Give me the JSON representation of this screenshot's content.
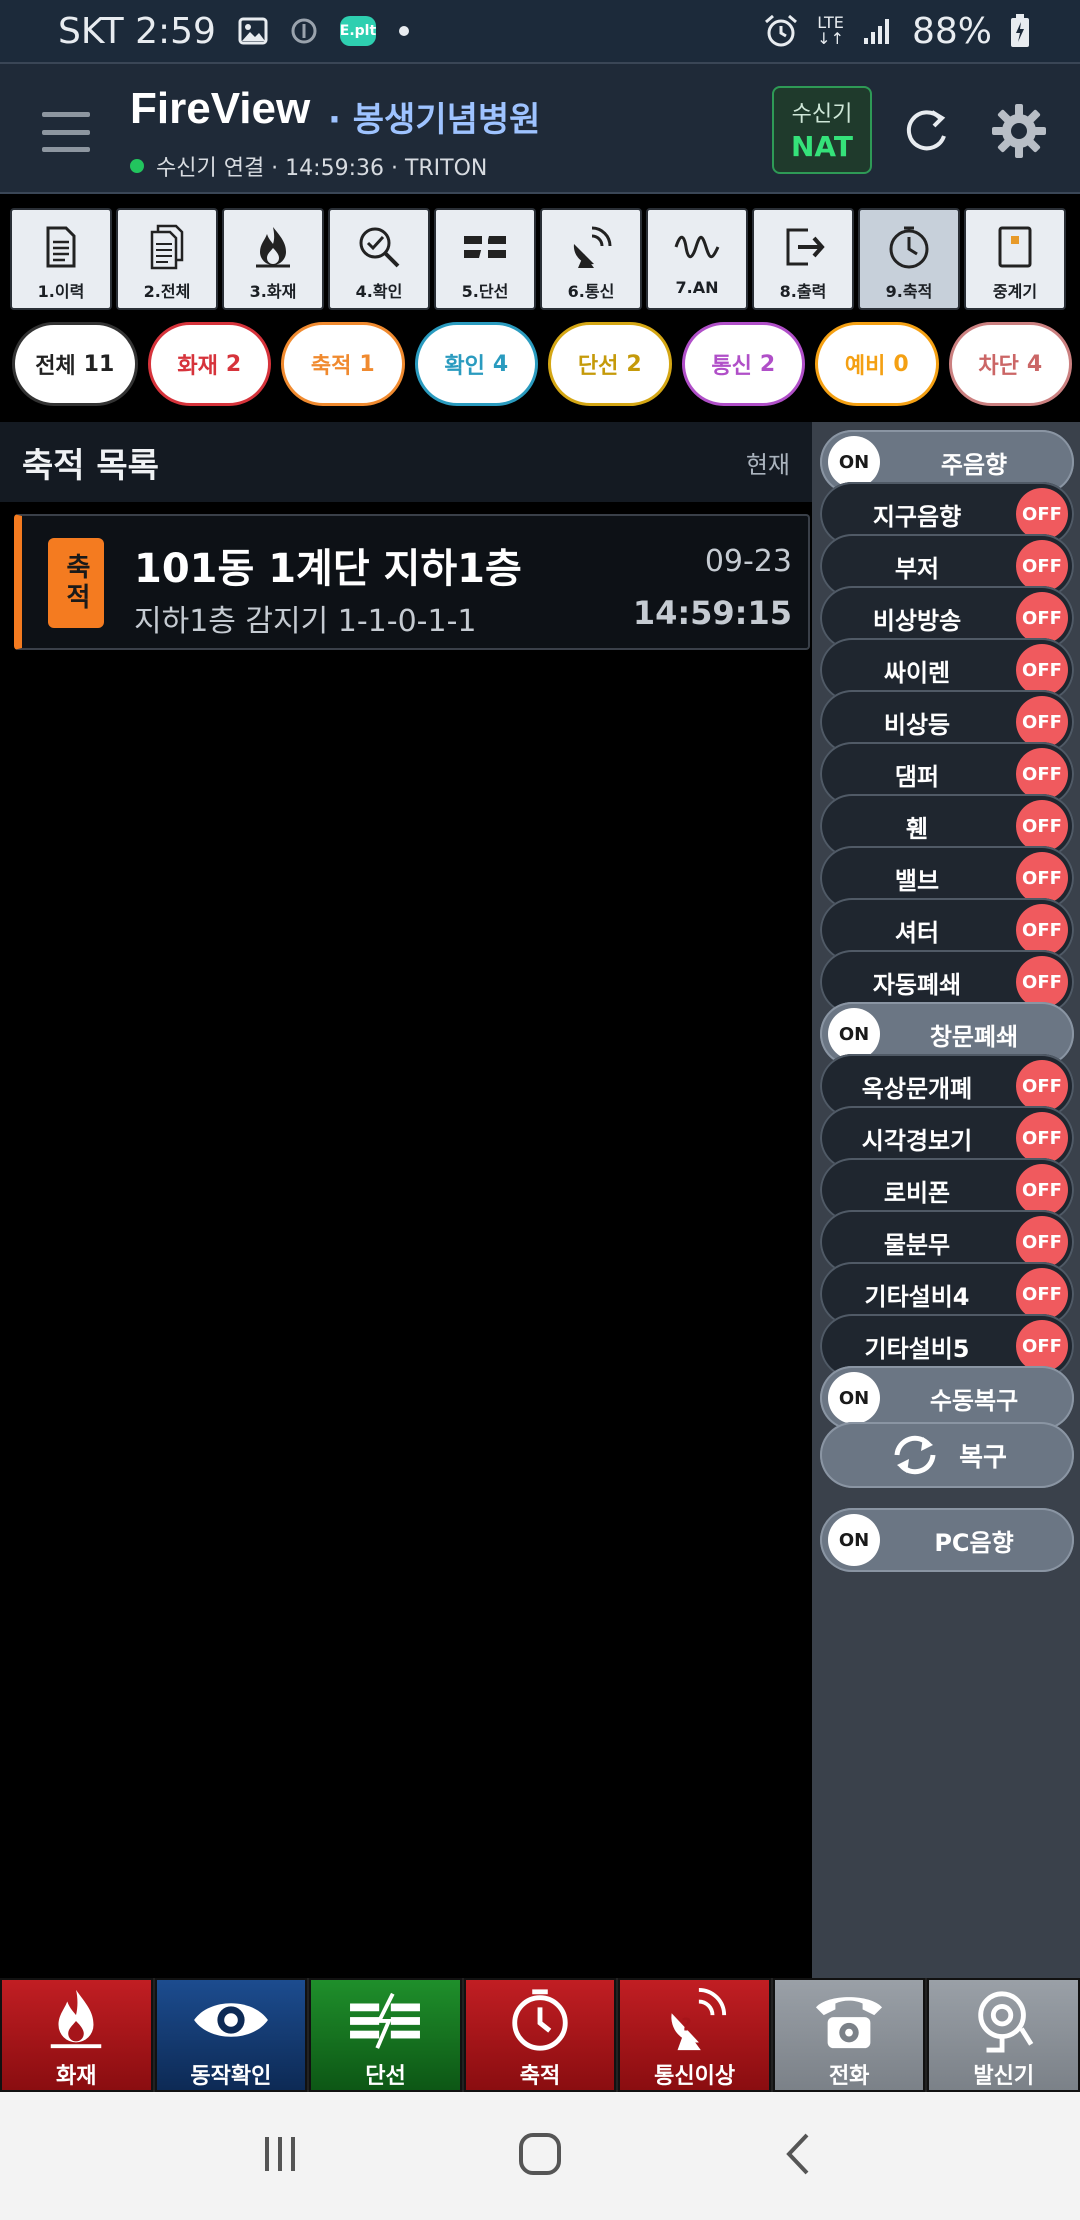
{
  "status_bar": {
    "carrier_time": "SKT 2:59",
    "eplt": "E.plt",
    "network": "LTE",
    "battery": "88%"
  },
  "header": {
    "app_title": "FireView",
    "hospital": "· 봉생기념병원",
    "connection": "수신기 연결 · 14:59:36 · TRITON",
    "receiver_label": "수신기",
    "receiver_value": "NAT"
  },
  "toolbar": [
    {
      "label": "1.이력",
      "icon": "document-icon"
    },
    {
      "label": "2.전체",
      "icon": "documents-icon"
    },
    {
      "label": "3.화재",
      "icon": "fire-icon"
    },
    {
      "label": "4.확인",
      "icon": "check-magnifier-icon"
    },
    {
      "label": "5.단선",
      "icon": "broken-line-icon"
    },
    {
      "label": "6.통신",
      "icon": "satellite-icon"
    },
    {
      "label": "7.AN",
      "icon": "wave-icon"
    },
    {
      "label": "8.출력",
      "icon": "exit-icon"
    },
    {
      "label": "9.축적",
      "icon": "clock-icon"
    },
    {
      "label": "중계기",
      "icon": "repeater-icon"
    }
  ],
  "chips": [
    {
      "label": "전체",
      "count": "11"
    },
    {
      "label": "화재",
      "count": "2"
    },
    {
      "label": "축적",
      "count": "1"
    },
    {
      "label": "확인",
      "count": "4"
    },
    {
      "label": "단선",
      "count": "2"
    },
    {
      "label": "통신",
      "count": "2"
    },
    {
      "label": "예비",
      "count": "0"
    },
    {
      "label": "차단",
      "count": "4"
    }
  ],
  "list": {
    "title": "축적 목록",
    "now_label": "현재",
    "events": [
      {
        "badge": "축적",
        "title": "101동 1계단 지하1층",
        "subtitle": "지하1층  감지기 1-1-0-1-1",
        "date": "09-23",
        "time": "14:59:15"
      }
    ]
  },
  "panel": {
    "on_text": "ON",
    "off_text": "OFF",
    "toggles": [
      {
        "label": "주음향",
        "state": "on"
      },
      {
        "label": "지구음향",
        "state": "off"
      },
      {
        "label": "부저",
        "state": "off"
      },
      {
        "label": "비상방송",
        "state": "off"
      },
      {
        "label": "싸이렌",
        "state": "off"
      },
      {
        "label": "비상등",
        "state": "off"
      },
      {
        "label": "댐퍼",
        "state": "off"
      },
      {
        "label": "휀",
        "state": "off"
      },
      {
        "label": "밸브",
        "state": "off"
      },
      {
        "label": "셔터",
        "state": "off"
      },
      {
        "label": "자동폐쇄",
        "state": "off"
      },
      {
        "label": "창문폐쇄",
        "state": "on"
      },
      {
        "label": "옥상문개폐",
        "state": "off"
      },
      {
        "label": "시각경보기",
        "state": "off"
      },
      {
        "label": "로비폰",
        "state": "off"
      },
      {
        "label": "물분무",
        "state": "off"
      },
      {
        "label": "기타설비4",
        "state": "off"
      },
      {
        "label": "기타설비5",
        "state": "off"
      },
      {
        "label": "수동복구",
        "state": "on"
      }
    ],
    "restore_label": "복구",
    "pc_sound": {
      "label": "PC음향",
      "state": "on"
    }
  },
  "bottom_nav": [
    {
      "label": "화재",
      "icon": "fire-icon"
    },
    {
      "label": "동작확인",
      "icon": "eye-icon"
    },
    {
      "label": "단선",
      "icon": "broken-line-icon"
    },
    {
      "label": "축적",
      "icon": "clock-icon"
    },
    {
      "label": "통신이상",
      "icon": "satellite-question-icon"
    },
    {
      "label": "전화",
      "icon": "phone-icon"
    },
    {
      "label": "발신기",
      "icon": "transmitter-icon"
    }
  ],
  "colors": {
    "accent_orange": "#f47b20",
    "on_state": "#6b7684",
    "off_state": "#f05a5e",
    "connected": "#22c55e"
  }
}
